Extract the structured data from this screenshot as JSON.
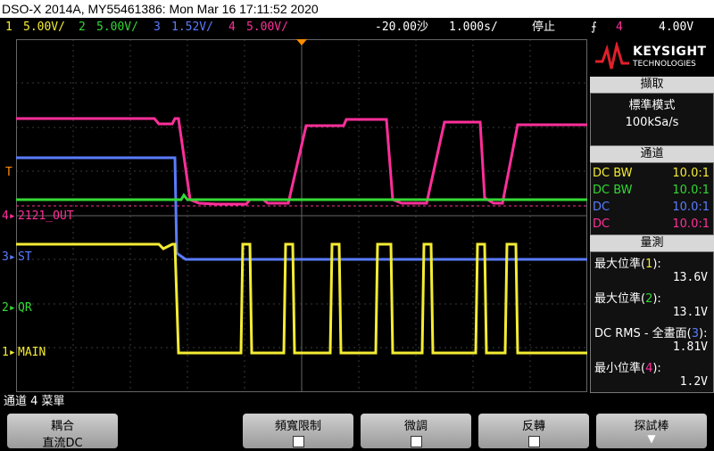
{
  "title": "DSO-X 2014A, MY55461386: Mon Mar 16 17:11:52 2020",
  "channels": [
    {
      "num": "1",
      "scale": "5.00V/",
      "color": "#f4ec33"
    },
    {
      "num": "2",
      "scale": "5.00V/",
      "color": "#34d834"
    },
    {
      "num": "3",
      "scale": "1.52V/",
      "color": "#5a7cff"
    },
    {
      "num": "4",
      "scale": "5.00V/",
      "color": "#ff2f9a"
    }
  ],
  "timebase": {
    "delay": "-20.00沙",
    "scale": "1.000s/",
    "state": "停止"
  },
  "trigger": {
    "source": "4",
    "level": "4.00V"
  },
  "trace_labels": {
    "ch4": "2121_OUT",
    "ch3": "ST",
    "ch2": "QR",
    "ch1": "MAIN",
    "trig": "T"
  },
  "brand": {
    "name": "KEYSIGHT",
    "sub": "TECHNOLOGIES"
  },
  "acquisition": {
    "header": "擷取",
    "mode": "標準模式",
    "rate": "100kSa/s"
  },
  "channel_panel": {
    "header": "通道",
    "rows": [
      {
        "coupling": "DC BW",
        "probe": "10.0:1",
        "color": "#f4ec33"
      },
      {
        "coupling": "DC BW",
        "probe": "10.0:1",
        "color": "#34d834"
      },
      {
        "coupling": "DC",
        "probe": "10.0:1",
        "color": "#5a7cff"
      },
      {
        "coupling": "DC",
        "probe": "10.0:1",
        "color": "#ff2f9a"
      }
    ]
  },
  "measurements": {
    "header": "量測",
    "items": [
      {
        "label": "最大位準(",
        "ch": "1",
        "tail": "):",
        "value": "13.6V",
        "color": "#f4ec33"
      },
      {
        "label": "最大位準(",
        "ch": "2",
        "tail": "):",
        "value": "13.1V",
        "color": "#34d834"
      },
      {
        "label": "DC RMS - 全畫面(",
        "ch": "3",
        "tail": "):",
        "value": "1.81V",
        "color": "#5a7cff"
      },
      {
        "label": "最小位準(",
        "ch": "4",
        "tail": "):",
        "value": "1.2V",
        "color": "#ff2f9a"
      }
    ]
  },
  "menu_label": "通道 4 菜單",
  "softkeys": [
    {
      "top": "耦合",
      "bottom": "直流DC"
    },
    {
      "top": "頻寬限制"
    },
    {
      "top": "微調"
    },
    {
      "top": "反轉"
    },
    {
      "top": "探試棒"
    }
  ]
}
